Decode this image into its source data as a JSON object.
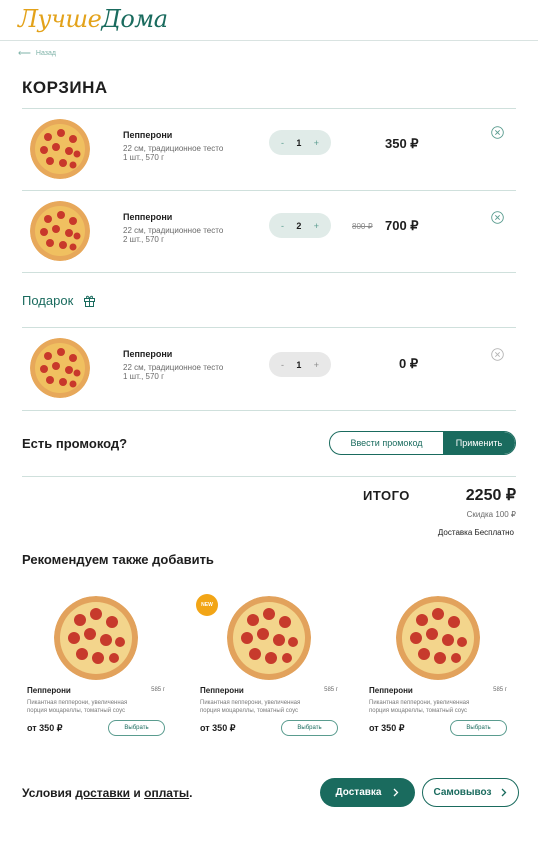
{
  "header": {
    "logo_part1": "Лучше",
    "logo_part2": "Дома"
  },
  "nav": {
    "back_label": "Назад"
  },
  "page": {
    "title": "КОРЗИНА"
  },
  "cart": {
    "items": [
      {
        "name": "Пепперони",
        "desc": "22 см, традиционное тесто",
        "meta": "1 шт.,  570 г",
        "qty": "1",
        "minus": "-",
        "plus": "+",
        "price": "350 ₽",
        "old_price": ""
      },
      {
        "name": "Пепперони",
        "desc": "22 см, традиционное тесто",
        "meta": "2 шт.,  570 г",
        "qty": "2",
        "minus": "-",
        "plus": "+",
        "price": "700 ₽",
        "old_price": "800 ₽"
      }
    ],
    "gift_title": "Подарок",
    "gift_item": {
      "name": "Пепперони",
      "desc": "22 см, традиционное тесто",
      "meta": "1 шт.,  570 г",
      "qty": "1",
      "minus": "-",
      "plus": "+",
      "price": "0 ₽"
    }
  },
  "promo": {
    "question": "Есть промокод?",
    "input_label": "Ввести промокод",
    "apply_label": "Применить"
  },
  "summary": {
    "total_label": "ИТОГО",
    "total_value": "2250 ₽",
    "discount": "Скидка 100 ₽",
    "delivery": "Доставка  Бесплатно"
  },
  "recommend": {
    "title": "Рекомендуем также добавить",
    "cards": [
      {
        "name": "Пепперони",
        "weight": "585 г",
        "desc": "Пикантная пепперони, увеличенная порция моцареллы, томатный соус",
        "price": "от 350 ₽",
        "button": "Выбрать",
        "badge": ""
      },
      {
        "name": "Пепперони",
        "weight": "585 г",
        "desc": "Пикантная пепперони, увеличенная порция моцареллы, томатный соус",
        "price": "от 350 ₽",
        "button": "Выбрать",
        "badge": "NEW"
      },
      {
        "name": "Пепперони",
        "weight": "585 г",
        "desc": "Пикантная пепперони, увеличенная порция моцареллы, томатный соус",
        "price": "от 350 ₽",
        "button": "Выбрать",
        "badge": ""
      }
    ]
  },
  "footer": {
    "terms_prefix": "Условия ",
    "terms_link1": "доставки",
    "terms_and": " и ",
    "terms_link2": "оплаты",
    "terms_suffix": ".",
    "delivery_button": "Доставка",
    "pickup_button": "Самовывоз"
  },
  "colors": {
    "brand_green": "#1a6b5e",
    "brand_yellow": "#e3a21a",
    "badge_orange": "#f2a516"
  },
  "icons": {
    "back": "arrow-left-icon",
    "remove": "close-circle-icon",
    "gift": "gift-icon",
    "chevron": "chevron-right-icon"
  }
}
